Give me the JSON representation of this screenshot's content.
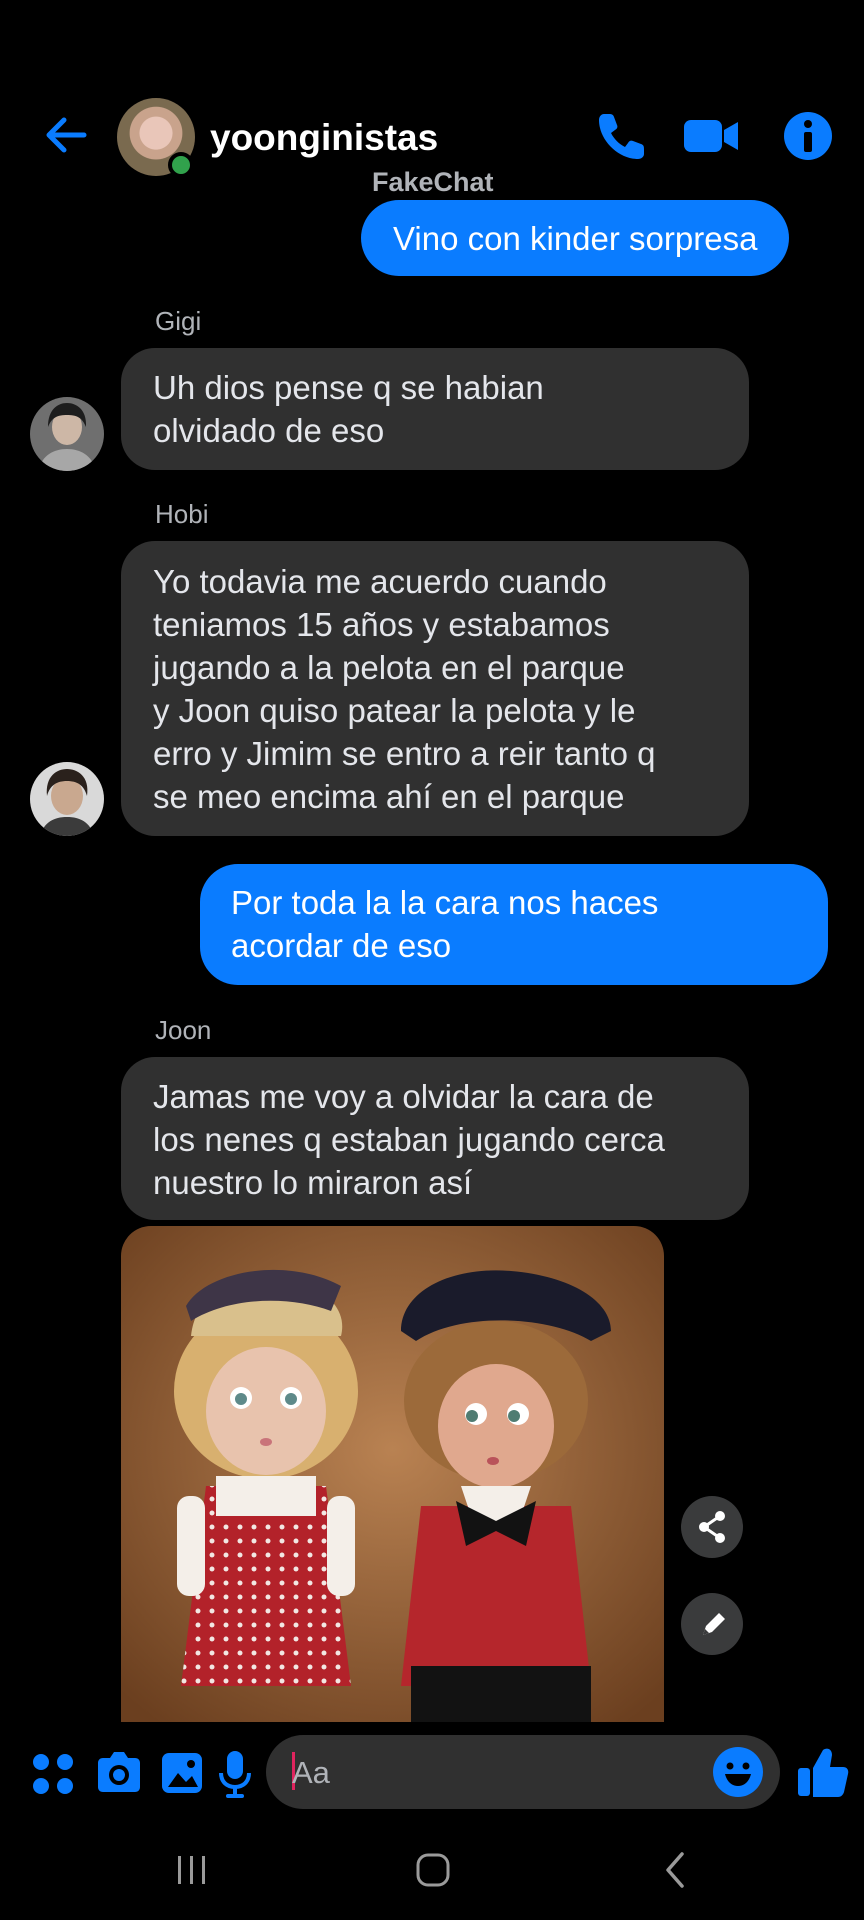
{
  "header": {
    "title": "yoonginistas",
    "subtitle": "FakeChat",
    "back_icon": "arrow-left-icon",
    "actions": [
      "phone-icon",
      "video-camera-icon",
      "info-icon"
    ],
    "accent": "#0a7cff"
  },
  "messages": [
    {
      "dir": "out",
      "text": "Vino con kinder sorpresa"
    },
    {
      "dir": "in",
      "sender": "Gigi",
      "lines": [
        "Uh dios pense q se habian",
        "olvidado de eso"
      ]
    },
    {
      "dir": "in",
      "sender": "Hobi",
      "lines": [
        "Yo todavia me acuerdo cuando",
        "teniamos 15 años y estabamos",
        "jugando a la pelota en el parque",
        "y Joon quiso patear la pelota y le",
        "erro y Jimim se entro a reir tanto q",
        "se meo encima ahí en el parque"
      ]
    },
    {
      "dir": "out",
      "lines": [
        "Por toda la la cara nos haces",
        "acordar de eso"
      ]
    },
    {
      "dir": "in",
      "sender": "Joon",
      "lines": [
        "Jamas me voy a olvidar la cara de",
        "los nenes q estaban jugando cerca",
        "nuestro lo miraron así"
      ]
    },
    {
      "dir": "in",
      "type": "image",
      "description_icon": "photo-two-dolls"
    }
  ],
  "image_actions": [
    "share-icon",
    "edit-icon"
  ],
  "composer": {
    "placeholder": "Aa",
    "icons": [
      "menu-dots-icon",
      "camera-icon",
      "gallery-icon",
      "microphone-icon",
      "emoji-icon",
      "thumbs-up-icon"
    ]
  },
  "system_nav": [
    "recent-apps-icon",
    "home-icon",
    "back-icon"
  ],
  "colors": {
    "outgoing": "#0a7cff",
    "incoming": "#303030",
    "online": "#31a24c"
  }
}
